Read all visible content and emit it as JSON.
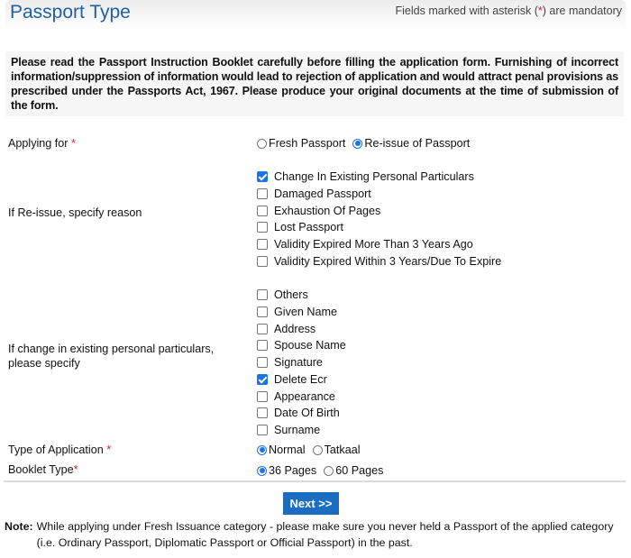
{
  "header": {
    "title": "Passport Type",
    "mandatory_note_prefix": "Fields marked with asterisk (",
    "mandatory_note_star": "*",
    "mandatory_note_suffix": ") are mandatory"
  },
  "instruction": "Please read the Passport Instruction Booklet carefully before filling the application form. Furnishing of incorrect information/suppression of information would lead to rejection of application and would attract penal provisions as prescribed under the Passports Act, 1967. Please produce your original documents at the time of submission of the form.",
  "applying_for": {
    "label": "Applying for",
    "required": "*",
    "options": [
      {
        "label": "Fresh Passport",
        "selected": false
      },
      {
        "label": "Re-issue of Passport",
        "selected": true
      }
    ]
  },
  "reissue_reason": {
    "label": "If Re-issue, specify reason",
    "options": [
      {
        "label": "Change In Existing Personal Particulars",
        "checked": true
      },
      {
        "label": "Damaged Passport",
        "checked": false
      },
      {
        "label": "Exhaustion Of Pages",
        "checked": false
      },
      {
        "label": "Lost Passport",
        "checked": false
      },
      {
        "label": "Validity Expired More Than 3 Years Ago",
        "checked": false
      },
      {
        "label": "Validity Expired Within 3 Years/Due To Expire",
        "checked": false
      }
    ]
  },
  "personal_particulars": {
    "label_line1": "If change in existing personal particulars,",
    "label_line2": "please specify",
    "options": [
      {
        "label": "Others",
        "checked": false
      },
      {
        "label": "Given Name",
        "checked": false
      },
      {
        "label": "Address",
        "checked": false
      },
      {
        "label": "Spouse Name",
        "checked": false
      },
      {
        "label": "Signature",
        "checked": false
      },
      {
        "label": "Delete Ecr",
        "checked": true
      },
      {
        "label": "Appearance",
        "checked": false
      },
      {
        "label": "Date Of Birth",
        "checked": false
      },
      {
        "label": "Surname",
        "checked": false
      }
    ]
  },
  "application_type": {
    "label": "Type of Application",
    "required": "*",
    "options": [
      {
        "label": "Normal",
        "selected": true
      },
      {
        "label": "Tatkaal",
        "selected": false
      }
    ]
  },
  "booklet_type": {
    "label": "Booklet Type",
    "required": "*",
    "options": [
      {
        "label": "36 Pages",
        "selected": true
      },
      {
        "label": "60 Pages",
        "selected": false
      }
    ]
  },
  "next_button": "Next >>",
  "note": {
    "label": "Note:",
    "text": "While applying under Fresh Issuance category - please make sure you never held a Passport of the applied category (i.e. Ordinary Passport, Diplomatic Passport or Official Passport) in the past."
  },
  "colors": {
    "title": "#1f5fa5",
    "required": "#e0181e",
    "accent": "#1a73e8",
    "button": "#1a6dc0"
  }
}
